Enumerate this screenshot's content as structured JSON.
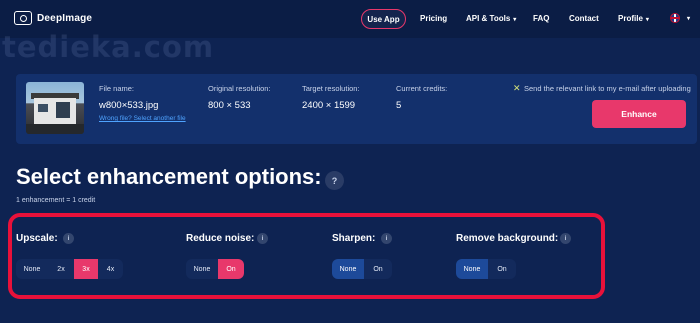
{
  "nav": {
    "logo_text": "DeepImage",
    "use_app": "Use App",
    "pricing": "Pricing",
    "api_tools": "API & Tools",
    "faq": "FAQ",
    "contact": "Contact",
    "profile": "Profile",
    "caret": "▾"
  },
  "watermark": "tedieka.com",
  "file": {
    "file_name_label": "File name:",
    "file_name": "w800×533.jpg",
    "wrong_file_link": "Wrong file? Select another file",
    "original_resolution_label": "Original resolution:",
    "original_resolution": "800 × 533",
    "target_resolution_label": "Target resolution:",
    "target_resolution": "2400 × 1599",
    "credits_label": "Current credits:",
    "credits": "5",
    "email_checkbox_mark": "✕",
    "email_label": "Send the relevant link to my e-mail after uploading",
    "enhance_button": "Enhance"
  },
  "title": "Select enhancement options:",
  "help_mark": "?",
  "subnote": "1 enhancement = 1 credit",
  "info_mark": "i",
  "options": {
    "upscale": {
      "label": "Upscale:",
      "choices": [
        "None",
        "2x",
        "3x",
        "4x"
      ],
      "selected": "3x"
    },
    "reduce_noise": {
      "label": "Reduce noise:",
      "choices": [
        "None",
        "On"
      ],
      "selected": "On"
    },
    "sharpen": {
      "label": "Sharpen:",
      "choices": [
        "None",
        "On"
      ],
      "selected": "None"
    },
    "remove_background": {
      "label": "Remove background:",
      "choices": [
        "None",
        "On"
      ],
      "selected": "None"
    }
  },
  "colors": {
    "background": "#0e2352",
    "accent": "#e8386b",
    "selected_blue": "#1d4a9a",
    "highlight_frame": "#e8113a"
  }
}
